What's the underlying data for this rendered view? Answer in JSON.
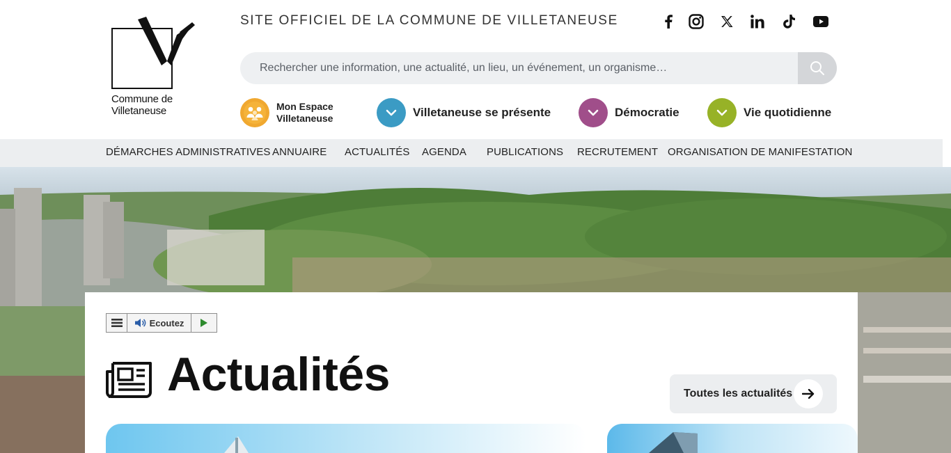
{
  "header": {
    "logo_text_line1": "Commune de",
    "logo_text_line2": "Villetaneuse",
    "site_title": "SITE OFFICIEL DE LA COMMUNE DE VILLETANEUSE",
    "social_icons": [
      "facebook-icon",
      "instagram-icon",
      "x-icon",
      "linkedin-icon",
      "tiktok-icon",
      "youtube-icon"
    ]
  },
  "search": {
    "placeholder": "Rechercher une information, une actualité, un lieu, un événement, un organisme…"
  },
  "quick_links": [
    {
      "line1": "Mon Espace",
      "line2": "Villetaneuse",
      "color": "#f0a830"
    },
    {
      "label": "Villetaneuse se présente",
      "color": "#3b9bc4"
    },
    {
      "label": "Démocratie",
      "color": "#a04e8a"
    },
    {
      "label": "Vie quotidienne",
      "color": "#97b227"
    }
  ],
  "nav": [
    "DÉMARCHES ADMINISTRATIVES",
    "ANNUAIRE",
    "ACTUALITÉS",
    "AGENDA",
    "PUBLICATIONS",
    "RECRUTEMENT",
    "ORGANISATION DE MANIFESTATION"
  ],
  "listen": {
    "label": "Ecoutez"
  },
  "news": {
    "title": "Actualités",
    "all_button": "Toutes les actualités"
  }
}
